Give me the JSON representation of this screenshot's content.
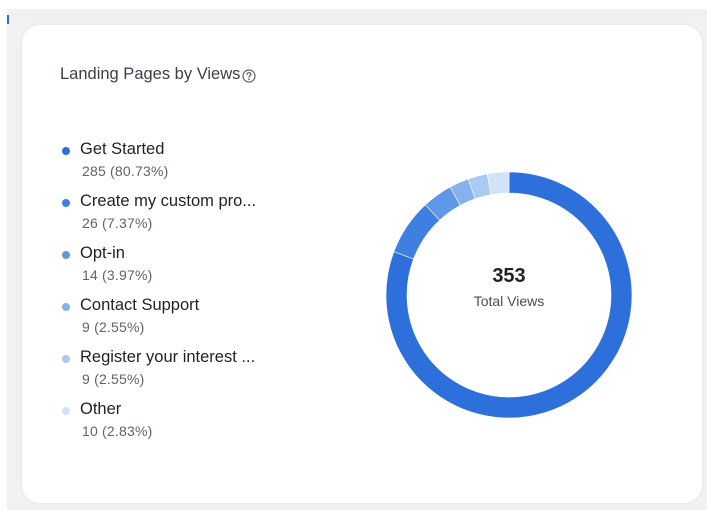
{
  "card": {
    "title": "Landing Pages by Views",
    "help_icon": "question-circle-icon"
  },
  "chart_data": {
    "type": "pie",
    "variant": "donut",
    "title": "Landing Pages by Views",
    "center": {
      "value": "353",
      "label": "Total Views"
    },
    "total": 353,
    "series": [
      {
        "name": "Get Started",
        "value": 285,
        "display": "285 (80.73%)",
        "color": "#2d6fdb"
      },
      {
        "name": "Create my custom pro...",
        "value": 26,
        "display": "26 (7.37%)",
        "color": "#3e7fe0"
      },
      {
        "name": "Opt-in",
        "value": 14,
        "display": "14 (3.97%)",
        "color": "#5e96e8"
      },
      {
        "name": "Contact Support",
        "value": 9,
        "display": "9 (2.55%)",
        "color": "#86b0ee"
      },
      {
        "name": "Register your interest ...",
        "value": 9,
        "display": "9 (2.55%)",
        "color": "#aac9f3"
      },
      {
        "name": "Other",
        "value": 10,
        "display": "10 (2.83%)",
        "color": "#d2e3f9"
      }
    ],
    "legend_position": "left",
    "grid": false
  }
}
